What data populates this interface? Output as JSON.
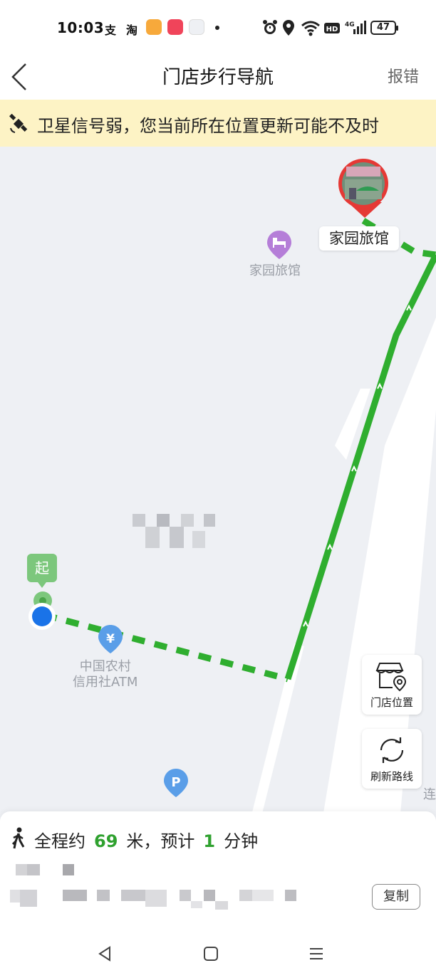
{
  "status_bar": {
    "time": "10:03",
    "app1": "支",
    "app2": "淘",
    "battery": "47"
  },
  "header": {
    "title": "门店步行导航",
    "report_label": "报错"
  },
  "banner": {
    "message": "卫星信号弱，您当前所在位置更新可能不及时"
  },
  "map": {
    "destination_label": "家园旅馆",
    "hotel_poi_label": "家园旅馆",
    "atm_poi_line1": "中国农村",
    "atm_poi_line2": "信用社ATM",
    "start_label": "起",
    "road_partial_label": "连",
    "buttons": {
      "store_location": "门店位置",
      "refresh_route": "刷新路线"
    },
    "route_color": "#2fae2f",
    "user_dot_color": "#1a73e8"
  },
  "panel": {
    "prefix": "全程约",
    "distance": "69",
    "middle": "米，预计",
    "minutes": "1",
    "suffix": "分钟",
    "copy_label": "复制"
  }
}
